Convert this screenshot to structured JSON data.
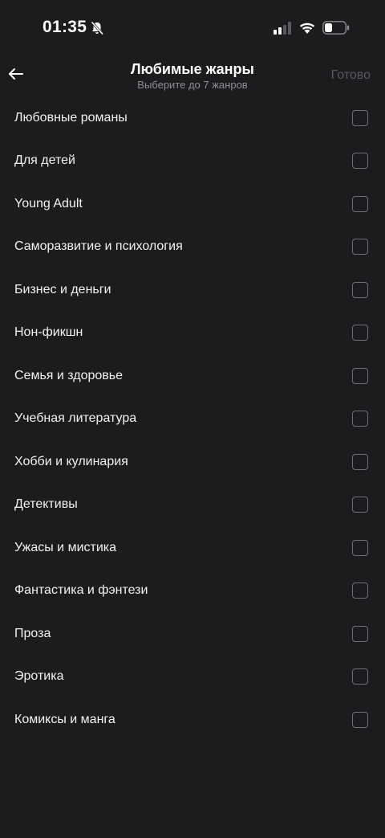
{
  "status_bar": {
    "time": "01:35"
  },
  "header": {
    "title": "Любимые жанры",
    "subtitle": "Выберите до 7 жанров",
    "done_label": "Готово"
  },
  "genres": [
    {
      "label": "Любовные романы",
      "checked": false
    },
    {
      "label": "Для детей",
      "checked": false
    },
    {
      "label": "Young Adult",
      "checked": false
    },
    {
      "label": "Саморазвитие и психология",
      "checked": false
    },
    {
      "label": "Бизнес и деньги",
      "checked": false
    },
    {
      "label": "Нон-фикшн",
      "checked": false
    },
    {
      "label": "Семья и здоровье",
      "checked": false
    },
    {
      "label": "Учебная литература",
      "checked": false
    },
    {
      "label": "Хобби и кулинария",
      "checked": false
    },
    {
      "label": "Детективы",
      "checked": false
    },
    {
      "label": "Ужасы и мистика",
      "checked": false
    },
    {
      "label": "Фантастика и фэнтези",
      "checked": false
    },
    {
      "label": "Проза",
      "checked": false
    },
    {
      "label": "Эротика",
      "checked": false
    },
    {
      "label": "Комиксы и манга",
      "checked": false
    }
  ],
  "icons": {
    "back": "arrow-left-icon",
    "bell": "bell-slash-icon",
    "signal": "cellular-signal-icon",
    "wifi": "wifi-icon",
    "battery": "battery-icon"
  },
  "colors": {
    "background": "#1c1c1e",
    "text": "#f2f2f2",
    "subtitle": "#8e8e93",
    "done_disabled": "#5a5a5e",
    "checkbox_border": "#6e6e73"
  }
}
